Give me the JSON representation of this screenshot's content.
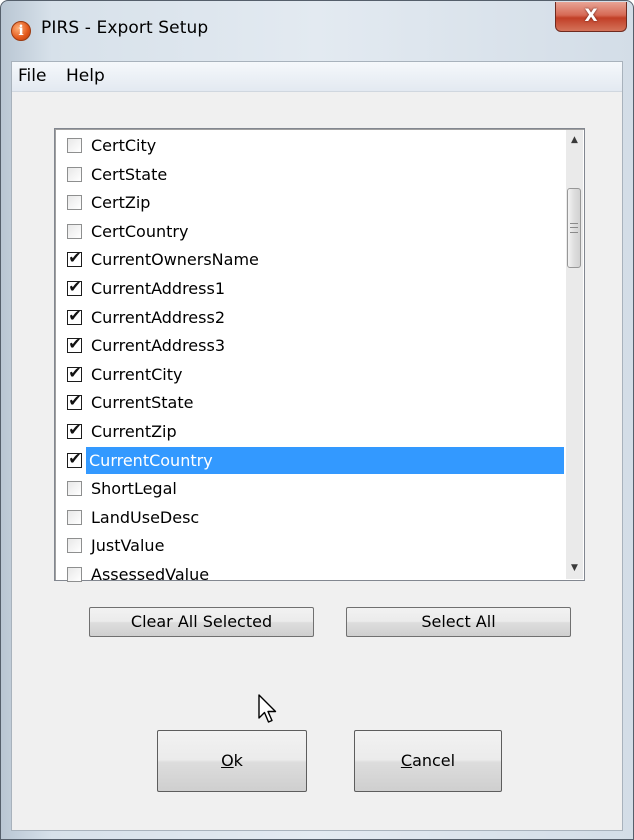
{
  "window": {
    "title": "PIRS - Export Setup",
    "close_glyph": "X",
    "icon": "info-icon",
    "icon_glyph": "i"
  },
  "menu": {
    "items": [
      "File",
      "Help"
    ]
  },
  "list": {
    "items": [
      {
        "label": "CertCity",
        "checked": false
      },
      {
        "label": "CertState",
        "checked": false
      },
      {
        "label": "CertZip",
        "checked": false
      },
      {
        "label": "CertCountry",
        "checked": false
      },
      {
        "label": "CurrentOwnersName",
        "checked": true
      },
      {
        "label": "CurrentAddress1",
        "checked": true
      },
      {
        "label": "CurrentAddress2",
        "checked": true
      },
      {
        "label": "CurrentAddress3",
        "checked": true
      },
      {
        "label": "CurrentCity",
        "checked": true
      },
      {
        "label": "CurrentState",
        "checked": true
      },
      {
        "label": "CurrentZip",
        "checked": true
      },
      {
        "label": "CurrentCountry",
        "checked": true,
        "selected": true
      },
      {
        "label": "ShortLegal",
        "checked": false
      },
      {
        "label": "LandUseDesc",
        "checked": false
      },
      {
        "label": "JustValue",
        "checked": false
      },
      {
        "label": "AssessedValue",
        "checked": false
      }
    ],
    "check_glyph": "✔",
    "scroll_up_glyph": "▲",
    "scroll_down_glyph": "▼",
    "selection_color": "#3399ff"
  },
  "buttons": {
    "clear_all": "Clear All Selected",
    "select_all": "Select All",
    "ok": "Ok",
    "cancel": "Cancel"
  },
  "colors": {
    "close_button": "#c13f27",
    "client_background": "#f0f0f0"
  }
}
